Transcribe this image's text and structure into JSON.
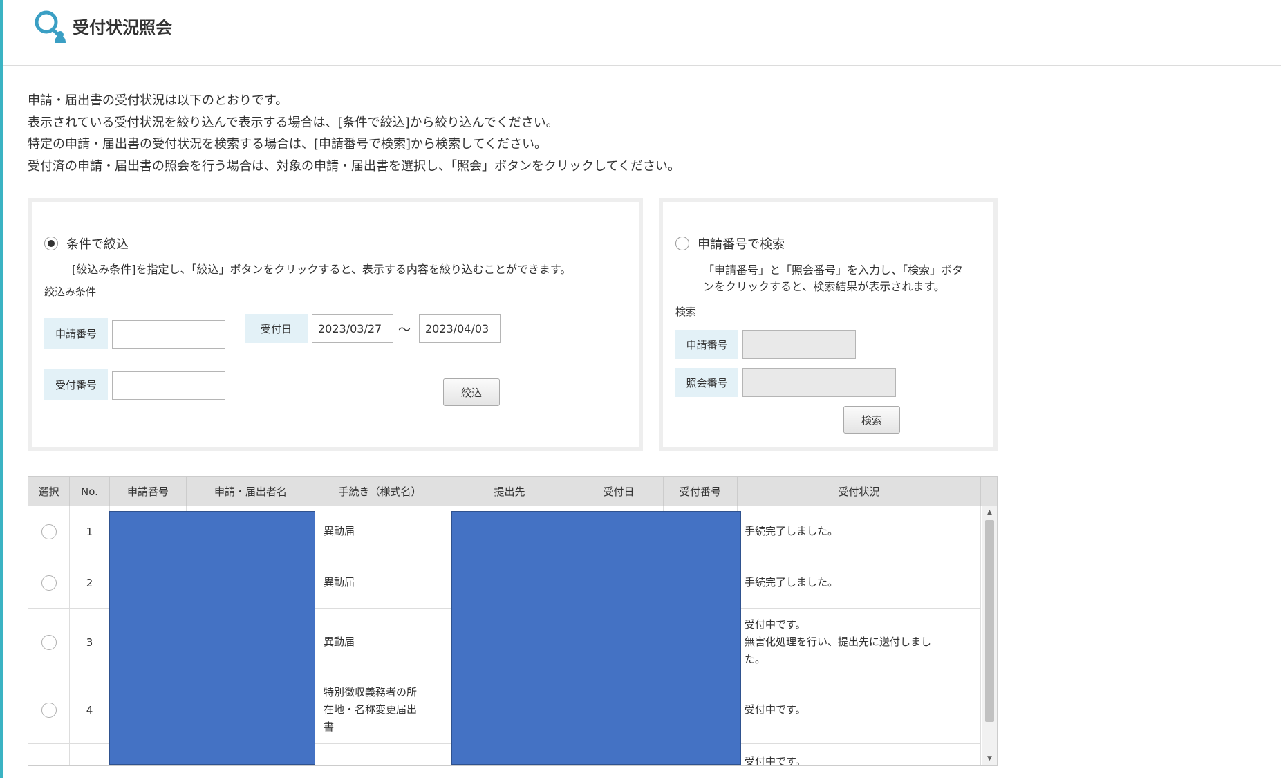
{
  "header": {
    "title": "受付状況照会",
    "icon": "search-person-icon"
  },
  "intro": [
    "申請・届出書の受付状況は以下のとおりです。",
    "表示されている受付状況を絞り込んで表示する場合は、[条件で絞込]から絞り込んでください。",
    "特定の申請・届出書の受付状況を検索する場合は、[申請番号で検索]から検索してください。",
    "受付済の申請・届出書の照会を行う場合は、対象の申請・届出書を選択し、「照会」ボタンをクリックしてください。"
  ],
  "filter": {
    "radio_label": "条件で絞込",
    "selected": true,
    "description": "[絞込み条件]を指定し、「絞込」ボタンをクリックすると、表示する内容を絞り込むことができます。",
    "section_label": "絞込み条件",
    "application_no_label": "申請番号",
    "application_no_value": "",
    "receipt_no_label": "受付番号",
    "receipt_no_value": "",
    "date_label": "受付日",
    "date_from": "2023/03/27",
    "date_sep": "～",
    "date_to": "2023/04/03",
    "button": "絞込"
  },
  "search": {
    "radio_label": "申請番号で検索",
    "selected": false,
    "description_lines": [
      "「申請番号」と「照会番号」を入力し、「検索」ボタ",
      "ンをクリックすると、検索結果が表示されます。"
    ],
    "section_label": "検索",
    "application_no_label": "申請番号",
    "application_no_value": "",
    "inquiry_no_label": "照会番号",
    "inquiry_no_value": "",
    "button": "検索"
  },
  "table": {
    "headers": [
      "選択",
      "No.",
      "申請番号",
      "申請・届出者名",
      "手続き（様式名）",
      "提出先",
      "受付日",
      "受付番号",
      "受付状況"
    ],
    "rows": [
      {
        "no": "1",
        "procedure": [
          "異動届"
        ],
        "status": [
          "手続完了しました。"
        ]
      },
      {
        "no": "2",
        "procedure": [
          "異動届"
        ],
        "status": [
          "手続完了しました。"
        ]
      },
      {
        "no": "3",
        "procedure": [
          "異動届"
        ],
        "status": [
          "受付中です。",
          "無害化処理を行い、提出先に送付しまし",
          "た。"
        ]
      },
      {
        "no": "4",
        "procedure": [
          "特別徴収義務者の所",
          "在地・名称変更届出",
          "書"
        ],
        "status": [
          "受付中です。"
        ]
      },
      {
        "no": "",
        "procedure": [
          ""
        ],
        "status": [
          "受付中です。"
        ]
      }
    ]
  },
  "colors": {
    "accent": "#3bb3c3",
    "label_bg": "#e3f1f7",
    "redaction": "#4472c4"
  }
}
